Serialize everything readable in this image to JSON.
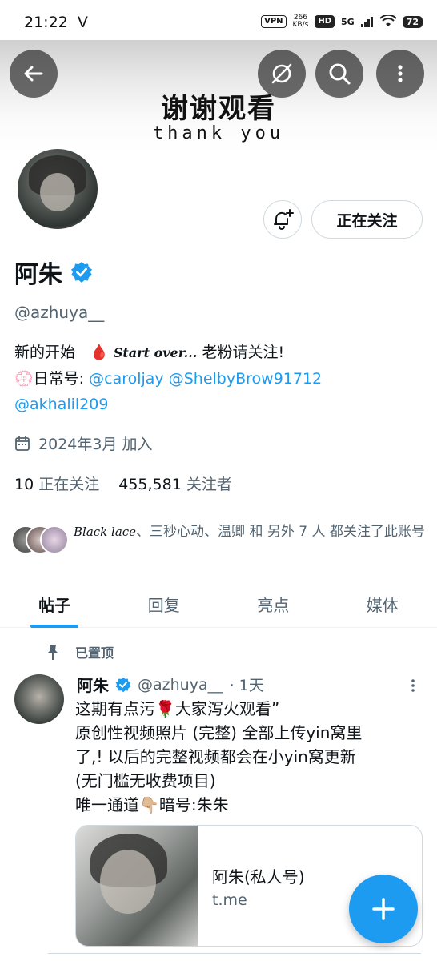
{
  "status_bar": {
    "time": "21:22",
    "carrier_glyph": "V",
    "vpn": "VPN",
    "speed_value": "266",
    "speed_unit": "KB/s",
    "hd": "HD",
    "network": "5G",
    "battery": "72"
  },
  "banner": {
    "title": "谢谢观看",
    "subtitle": "thank you"
  },
  "profile": {
    "name": "阿朱",
    "handle": "@azhuya__",
    "follow_state_label": "正在关注",
    "bio_line1_a": "新的开始",
    "bio_line1_drop": "🩸",
    "bio_line1_script": "Start over...",
    "bio_line1_b": "老粉请关注!",
    "bio_line2_flower": "💮",
    "bio_line2_label": "日常号:",
    "bio_mention1": "@caroljay",
    "bio_mention2": "@ShelbyBrow91712",
    "bio_mention3": "@akhalil209",
    "joined": "2024年3月 加入",
    "following_count": "10",
    "following_label": "正在关注",
    "followers_count": "455,581",
    "followers_label": "关注者"
  },
  "mutuals": {
    "script_name": "Black lace",
    "text": "、三秒心动、温卿 和 另外 7 人 都关注了此账号"
  },
  "tabs": [
    {
      "label": "帖子"
    },
    {
      "label": "回复"
    },
    {
      "label": "亮点"
    },
    {
      "label": "媒体"
    }
  ],
  "post": {
    "pinned_label": "已置顶",
    "author_name": "阿朱",
    "author_handle": "@azhuya__",
    "time": "· 1天",
    "line1": "这期有点污🌹大家泻火观看”",
    "line2": "原创性视频照片 (完整) 全部上传yin窝里",
    "line3": "了,! 以后的完整视频都会在小yin窝更新",
    "line4": "(无门槛无收费项目)",
    "line5": "唯一通道👇🏼暗号:朱朱",
    "card_title": "阿朱(私人号)",
    "card_domain": "t.me"
  },
  "colors": {
    "accent": "#1d9bf0",
    "secondary_text": "#536471",
    "primary_text": "#0f1419",
    "border": "#cfd9de"
  },
  "icons": [
    "back-arrow-icon",
    "hide-icon",
    "search-icon",
    "more-vertical-icon",
    "bell-plus-icon",
    "verified-badge-icon",
    "calendar-icon",
    "pin-icon",
    "compose-plus-icon"
  ]
}
